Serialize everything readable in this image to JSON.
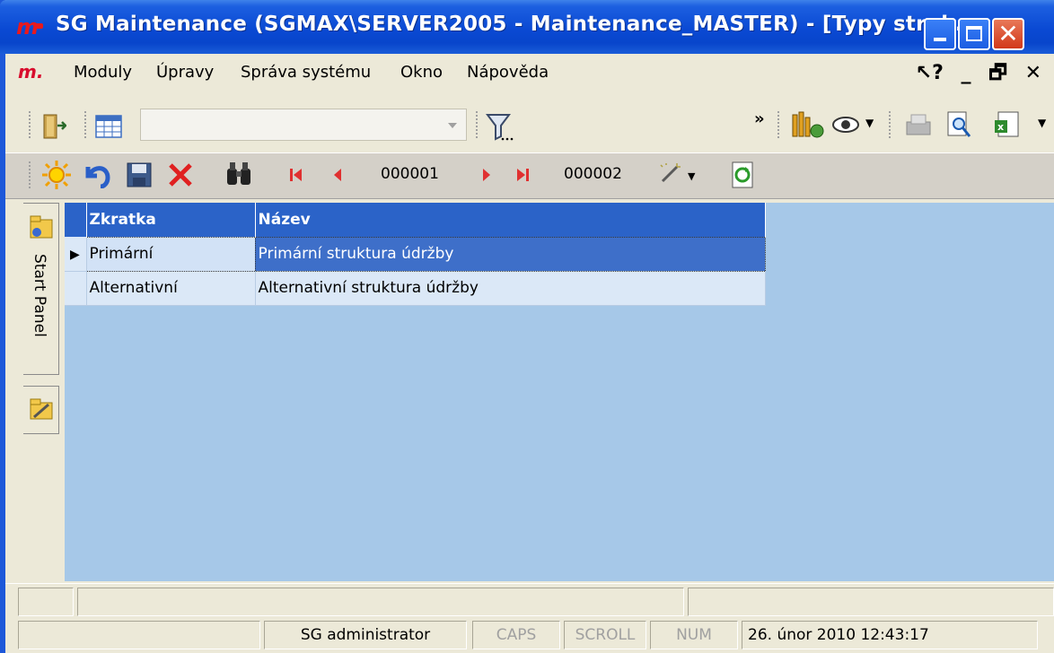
{
  "window": {
    "title": "SG Maintenance (SGMAX\\SERVER2005 - Maintenance_MASTER) - [Typy struk...",
    "app_logo": "m."
  },
  "menubar": {
    "logo": "m.",
    "items": [
      "Moduly",
      "Úpravy",
      "Správa systému",
      "Okno",
      "Nápověda"
    ]
  },
  "toolbar1": {
    "filter_combo_value": "",
    "overflow": "»"
  },
  "toolbar2": {
    "record_current": "000001",
    "record_total": "000002"
  },
  "side_panel": {
    "start_panel_label": "Start Panel"
  },
  "grid": {
    "columns": [
      "Zkratka",
      "Název"
    ],
    "rows": [
      {
        "zkratka": "Primární",
        "nazev": "Primární struktura údržby",
        "selected": true
      },
      {
        "zkratka": "Alternativní",
        "nazev": "Alternativní struktura údržby",
        "selected": false
      }
    ]
  },
  "statusbar": {
    "user": "SG administrator",
    "caps": "CAPS",
    "scroll": "SCROLL",
    "num": "NUM",
    "datetime": "26. únor 2010 12:43:17"
  },
  "colors": {
    "titlebar": "#0a49d3",
    "grid_header": "#2b63c8",
    "client_bg": "#a6c8e8",
    "selected_cell": "#3e6fc9"
  }
}
